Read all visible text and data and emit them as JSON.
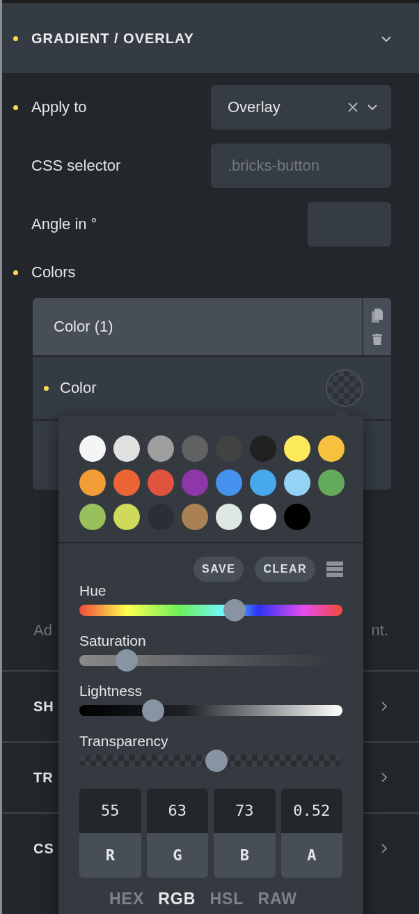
{
  "section": {
    "title": "GRADIENT / OVERLAY",
    "modified": true,
    "expanded": true
  },
  "fields": [
    {
      "kind": "select",
      "label": "Apply to",
      "modified": true,
      "value": "Overlay"
    },
    {
      "kind": "text",
      "label": "CSS selector",
      "modified": false,
      "placeholder": ".bricks-button"
    },
    {
      "kind": "number",
      "label": "Angle in °",
      "modified": false
    }
  ],
  "colors": {
    "label": "Colors",
    "modified": true,
    "items": [
      {
        "title": "Color (1)",
        "field_label": "Color",
        "modified": true
      }
    ]
  },
  "hint_fragments": [
    "Ad",
    "nt."
  ],
  "collapsed_sections": [
    {
      "title": "SH",
      "expanded": false
    },
    {
      "title": "TR",
      "expanded": false
    },
    {
      "title": "CS",
      "expanded": false
    }
  ],
  "picker": {
    "swatches": [
      {
        "color": "#f5f5f5"
      },
      {
        "color": "#e0e0e0"
      },
      {
        "color": "#9e9e9e"
      },
      {
        "color": "#616161"
      },
      {
        "color": "#424242"
      },
      {
        "color": "#212121"
      },
      {
        "color": "#fde95c"
      },
      {
        "color": "#f6c13e"
      },
      {
        "color": "#f29c36"
      },
      {
        "color": "#ec6434"
      },
      {
        "color": "#e0533f"
      },
      {
        "color": "#8e37a8"
      },
      {
        "color": "#4591ed"
      },
      {
        "color": "#47a8ed"
      },
      {
        "color": "#95d3f6"
      },
      {
        "color": "#64aa5b"
      },
      {
        "color": "#98c15d"
      },
      {
        "color": "#cfd95a"
      },
      {
        "color": "#2a2f36"
      },
      {
        "color": "#a98152"
      },
      {
        "color": "#dfe7e3"
      },
      {
        "color": "#ffffff"
      },
      {
        "color": "#000000"
      }
    ],
    "buttons": [
      "SAVE",
      "CLEAR"
    ],
    "sliders": [
      {
        "kind": "hue",
        "label": "Hue",
        "level": 0.59
      },
      {
        "kind": "saturation",
        "label": "Saturation",
        "level": 0.18
      },
      {
        "kind": "lightness",
        "label": "Lightness",
        "level": 0.28
      },
      {
        "kind": "transparency",
        "label": "Transparency",
        "level": 0.52
      }
    ],
    "channels": [
      {
        "value": "55",
        "label": "R"
      },
      {
        "value": "63",
        "label": "G"
      },
      {
        "value": "73",
        "label": "B"
      },
      {
        "value": "0.52",
        "label": "A"
      }
    ],
    "modes": [
      {
        "label": "HEX",
        "selected": false
      },
      {
        "label": "RGB",
        "selected": true
      },
      {
        "label": "HSL",
        "selected": false
      },
      {
        "label": "RAW",
        "selected": false
      }
    ]
  }
}
